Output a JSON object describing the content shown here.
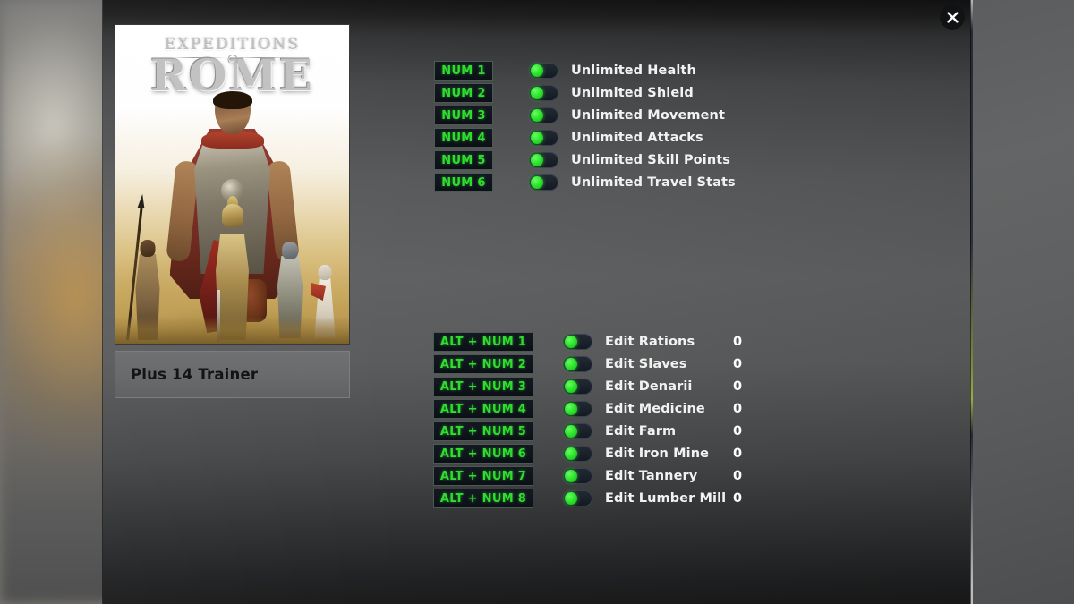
{
  "window": {
    "close_label": "×",
    "close_icon": "close-icon"
  },
  "cover": {
    "title_top": "EXPEDITIONS",
    "title_main": "ROME"
  },
  "trainer": {
    "name": "Plus 14 Trainer"
  },
  "colors": {
    "accent_green": "#2fdd2f",
    "knob_green": "#2ee32e",
    "hotkey_bg": "#10141c",
    "label_white": "#f2f2f2",
    "panel_gray": "#6a6b6c"
  },
  "options_primary": [
    {
      "hotkey": "NUM 1",
      "label": "Unlimited Health",
      "enabled": true
    },
    {
      "hotkey": "NUM 2",
      "label": "Unlimited Shield",
      "enabled": true
    },
    {
      "hotkey": "NUM 3",
      "label": "Unlimited Movement",
      "enabled": true
    },
    {
      "hotkey": "NUM 4",
      "label": "Unlimited Attacks",
      "enabled": true
    },
    {
      "hotkey": "NUM 5",
      "label": "Unlimited Skill Points",
      "enabled": true
    },
    {
      "hotkey": "NUM 6",
      "label": "Unlimited Travel Stats",
      "enabled": true
    }
  ],
  "options_editors": [
    {
      "hotkey": "ALT + NUM 1",
      "label": "Edit Rations",
      "value": "0",
      "enabled": true
    },
    {
      "hotkey": "ALT + NUM 2",
      "label": "Edit Slaves",
      "value": "0",
      "enabled": true
    },
    {
      "hotkey": "ALT + NUM 3",
      "label": "Edit Denarii",
      "value": "0",
      "enabled": true
    },
    {
      "hotkey": "ALT + NUM 4",
      "label": "Edit Medicine",
      "value": "0",
      "enabled": true
    },
    {
      "hotkey": "ALT + NUM 5",
      "label": "Edit Farm",
      "value": "0",
      "enabled": true
    },
    {
      "hotkey": "ALT + NUM 6",
      "label": "Edit Iron Mine",
      "value": "0",
      "enabled": true
    },
    {
      "hotkey": "ALT + NUM 7",
      "label": "Edit Tannery",
      "value": "0",
      "enabled": true
    },
    {
      "hotkey": "ALT + NUM 8",
      "label": "Edit Lumber Mill",
      "value": "0",
      "enabled": true
    }
  ]
}
